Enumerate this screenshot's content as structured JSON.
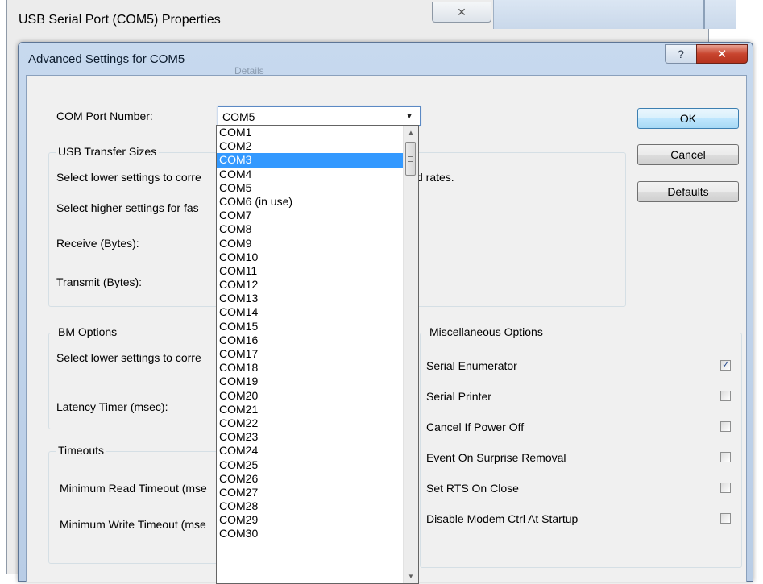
{
  "background_window": {
    "title": "USB Serial Port (COM5) Properties",
    "close_symbol": "✕",
    "ghost_tab": "Details"
  },
  "dialog": {
    "title": "Advanced Settings for COM5",
    "help_symbol": "?",
    "close_symbol": "✕"
  },
  "com_port": {
    "label": "COM Port Number:",
    "value": "COM5"
  },
  "buttons": {
    "ok": "OK",
    "cancel": "Cancel",
    "defaults": "Defaults"
  },
  "usb_transfer": {
    "title": "USB Transfer Sizes",
    "line1_start": "Select lower settings to corre",
    "line1_end": "d rates.",
    "line2_start": "Select higher settings for fas",
    "receive_label": "Receive (Bytes):",
    "transmit_label": "Transmit (Bytes):"
  },
  "bm_options": {
    "title": "BM Options",
    "line1_start": "Select lower settings to corre",
    "latency_label": "Latency Timer (msec):"
  },
  "timeouts": {
    "title": "Timeouts",
    "read_label": "Minimum Read Timeout (mse",
    "write_label": "Minimum Write Timeout (mse"
  },
  "misc": {
    "title": "Miscellaneous Options",
    "options": [
      {
        "label": "Serial Enumerator",
        "checked": true
      },
      {
        "label": "Serial Printer",
        "checked": false
      },
      {
        "label": "Cancel If Power Off",
        "checked": false
      },
      {
        "label": "Event On Surprise Removal",
        "checked": false
      },
      {
        "label": "Set RTS On Close",
        "checked": false
      },
      {
        "label": "Disable Modem Ctrl At Startup",
        "checked": false
      }
    ]
  },
  "dropdown": {
    "selected": "COM3",
    "items": [
      "COM1",
      "COM2",
      "COM3",
      "COM4",
      "COM5",
      "COM6 (in use)",
      "COM7",
      "COM8",
      "COM9",
      "COM10",
      "COM11",
      "COM12",
      "COM13",
      "COM14",
      "COM15",
      "COM16",
      "COM17",
      "COM18",
      "COM19",
      "COM20",
      "COM21",
      "COM22",
      "COM23",
      "COM24",
      "COM25",
      "COM26",
      "COM27",
      "COM28",
      "COM29",
      "COM30"
    ]
  },
  "icons": {
    "dropdown_arrow": "▼",
    "scroll_up": "▲",
    "scroll_down": "▼"
  }
}
